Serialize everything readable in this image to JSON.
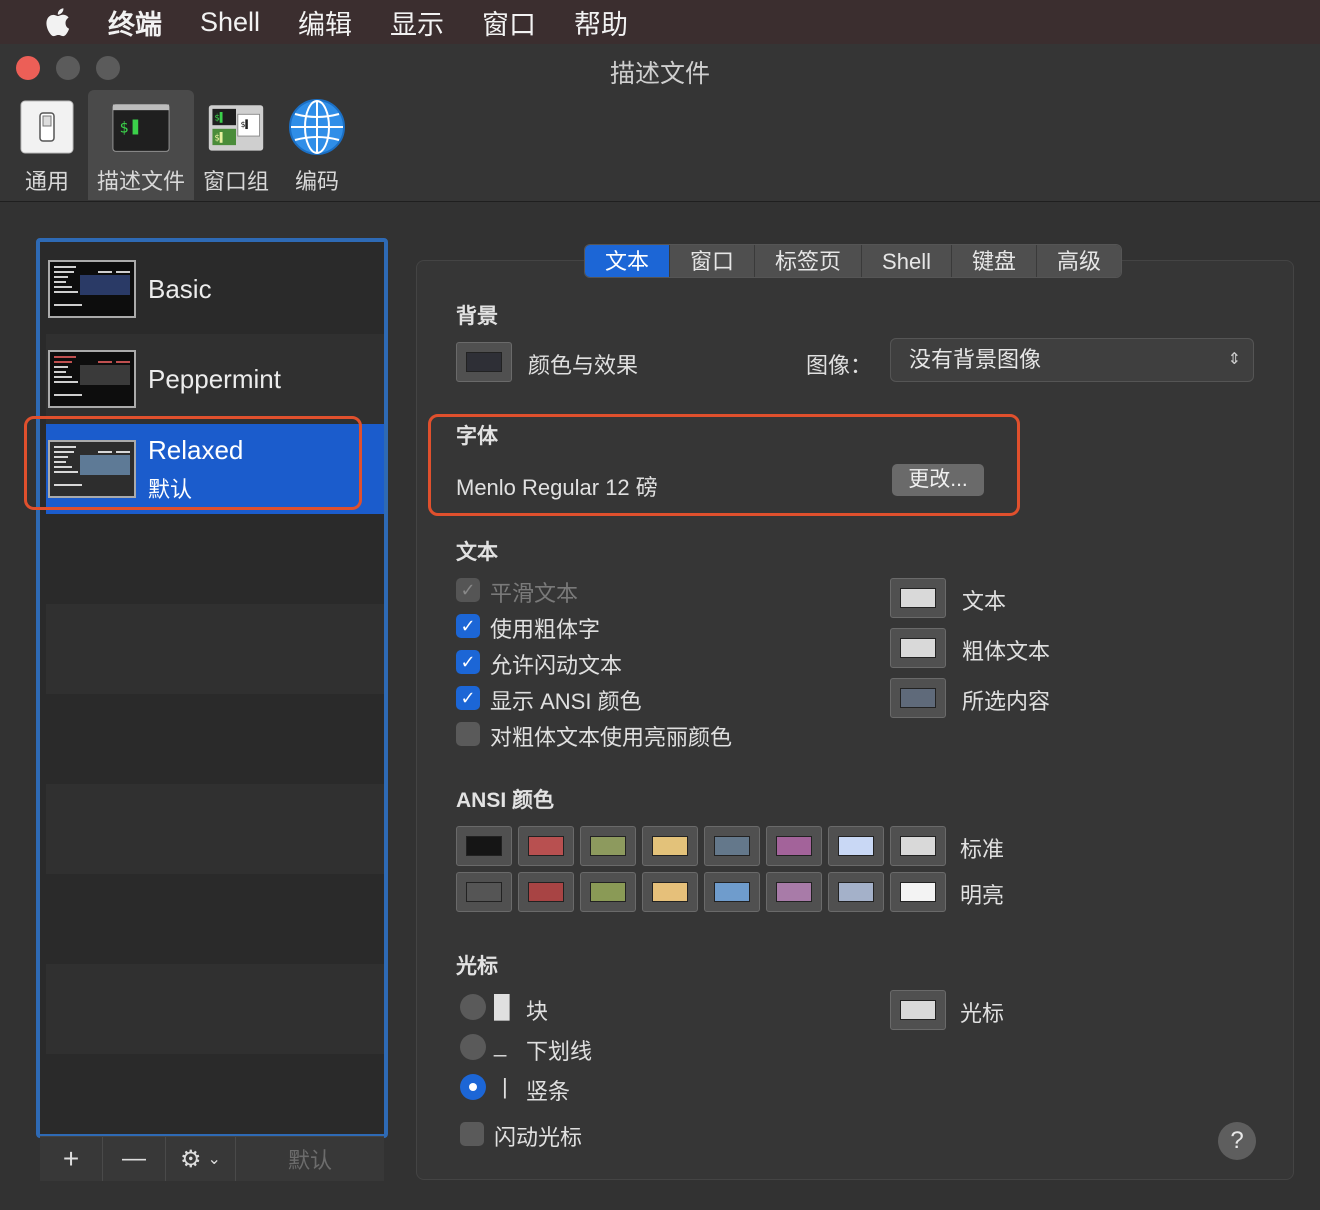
{
  "menubar": {
    "items": [
      "终端",
      "Shell",
      "编辑",
      "显示",
      "窗口",
      "帮助"
    ]
  },
  "window": {
    "title": "描述文件",
    "toolbar": [
      {
        "label": "通用",
        "icon": "switch-icon"
      },
      {
        "label": "描述文件",
        "icon": "terminal-icon"
      },
      {
        "label": "窗口组",
        "icon": "window-group-icon"
      },
      {
        "label": "编码",
        "icon": "globe-icon"
      }
    ]
  },
  "profiles": [
    {
      "name": "Basic",
      "sub": ""
    },
    {
      "name": "Peppermint",
      "sub": ""
    },
    {
      "name": "Relaxed",
      "sub": "默认"
    }
  ],
  "profile_bar": {
    "add": "+",
    "remove": "—",
    "default": "默认"
  },
  "tabs": [
    "文本",
    "窗口",
    "标签页",
    "Shell",
    "键盘",
    "高级"
  ],
  "background": {
    "section": "背景",
    "color_effects": "颜色与效果",
    "image_label": "图像：",
    "image_value": "没有背景图像"
  },
  "font": {
    "section": "字体",
    "value": "Menlo Regular 12 磅",
    "change": "更改..."
  },
  "text": {
    "section": "文本",
    "options": [
      {
        "label": "平滑文本",
        "state": "disabled"
      },
      {
        "label": "使用粗体字",
        "state": "on"
      },
      {
        "label": "允许闪动文本",
        "state": "on"
      },
      {
        "label": "显示 ANSI 颜色",
        "state": "on"
      },
      {
        "label": "对粗体文本使用亮丽颜色",
        "state": "off"
      }
    ],
    "colors": [
      {
        "label": "文本",
        "color": "#d9d9d9"
      },
      {
        "label": "粗体文本",
        "color": "#d9d9d9"
      },
      {
        "label": "所选内容",
        "color": "#5f6a7a"
      }
    ]
  },
  "ansi": {
    "section": "ANSI 颜色",
    "standard_label": "标准",
    "bright_label": "明亮",
    "standard": [
      "#151515",
      "#b85050",
      "#8d9a5e",
      "#e3c27a",
      "#64788b",
      "#a3639a",
      "#c9d8f5",
      "#d9d9d9"
    ],
    "bright": [
      "#555555",
      "#a84444",
      "#8a9a56",
      "#e6c07a",
      "#6f9ccc",
      "#a87ba8",
      "#a4b1c9",
      "#f3f3f3"
    ]
  },
  "cursor": {
    "section": "光标",
    "options": [
      {
        "glyph": "█",
        "label": "块",
        "state": "off"
      },
      {
        "glyph": "_",
        "label": "下划线",
        "state": "off"
      },
      {
        "glyph": "|",
        "label": "竖条",
        "state": "on"
      }
    ],
    "blink": "闪动光标",
    "color_label": "光标",
    "color": "#d9d9d9"
  },
  "help": "?"
}
